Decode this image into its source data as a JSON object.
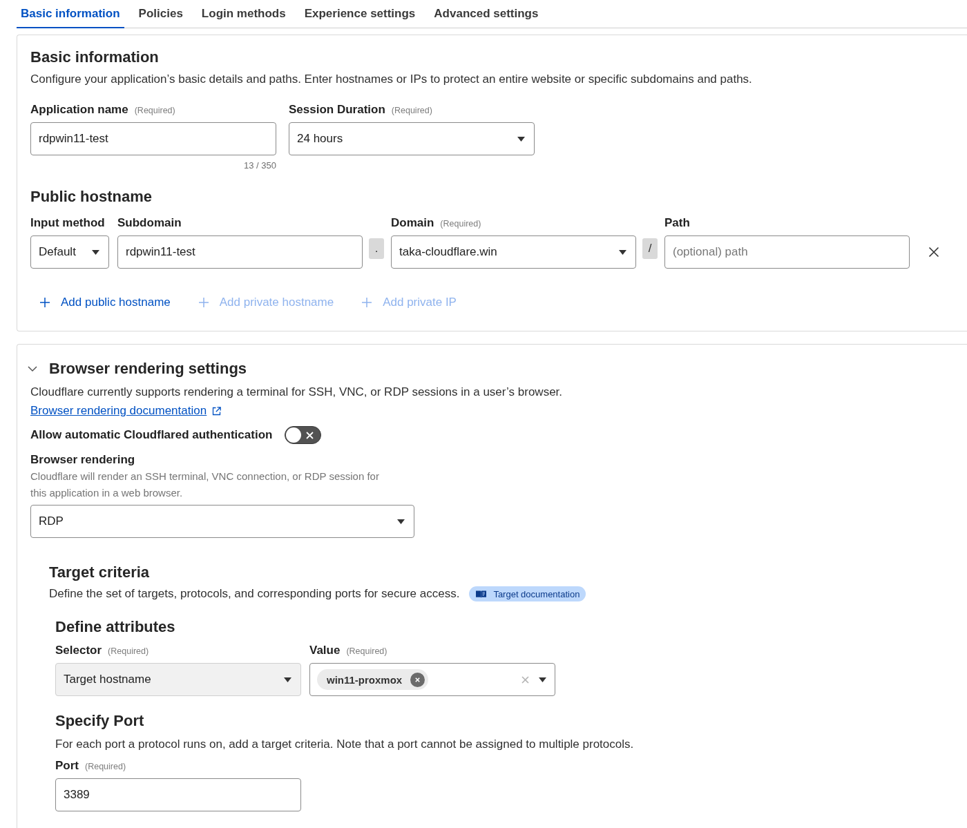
{
  "tabs": [
    {
      "label": "Basic information",
      "selected": true
    },
    {
      "label": "Policies",
      "selected": false
    },
    {
      "label": "Login methods",
      "selected": false
    },
    {
      "label": "Experience settings",
      "selected": false
    },
    {
      "label": "Advanced settings",
      "selected": false
    }
  ],
  "basic_information": {
    "title": "Basic information",
    "description": "Configure your application’s basic details and paths. Enter hostnames or IPs to protect an entire website or specific subdomains and paths.",
    "fields": [
      {
        "kind": "text",
        "label": "Application name",
        "required_note": "(Required)",
        "value": "rdpwin11-test",
        "counter": "13 / 350"
      },
      {
        "kind": "select",
        "label": "Session Duration",
        "required_note": "(Required)",
        "value": "24 hours"
      }
    ]
  },
  "public_hostname": {
    "title": "Public hostname",
    "fields": [
      {
        "kind": "select",
        "label": "Input method",
        "value": "Default"
      },
      {
        "kind": "text",
        "label": "Subdomain",
        "value": "rdpwin11-test"
      },
      {
        "kind": "separator",
        "text": "."
      },
      {
        "kind": "select",
        "label": "Domain",
        "required_note": "(Required)",
        "value": "taka-cloudflare.win"
      },
      {
        "kind": "separator",
        "text": "/"
      },
      {
        "kind": "text",
        "label": "Path",
        "placeholder": "(optional) path"
      }
    ],
    "actions": [
      {
        "label": "Add public hostname",
        "disabled": false
      },
      {
        "label": "Add private hostname",
        "disabled": true
      },
      {
        "label": "Add private IP",
        "disabled": true
      }
    ]
  },
  "browser_rendering": {
    "title": "Browser rendering settings",
    "expanded": true,
    "description": "Cloudflare currently supports rendering a terminal for SSH, VNC, or RDP sessions in a user’s browser.",
    "link": "Browser rendering documentation",
    "toggle": {
      "label": "Allow automatic Cloudflared authentication",
      "on": false
    },
    "rendering": {
      "label": "Browser rendering",
      "hint": "Cloudflare will render an SSH terminal, VNC connection, or RDP session for this application in a web browser.",
      "value": "RDP"
    }
  },
  "target_criteria": {
    "title": "Target criteria",
    "description": "Define the set of targets, protocols, and corresponding ports for secure access.",
    "badge": "Target documentation",
    "attributes": {
      "title": "Define attributes",
      "selector": {
        "label": "Selector",
        "required_note": "(Required)",
        "value": "Target hostname",
        "disabled": true
      },
      "value_field": {
        "label": "Value",
        "required_note": "(Required)",
        "chips": [
          "win11-proxmox"
        ]
      }
    },
    "port": {
      "title": "Specify Port",
      "description": "For each port a protocol runs on, add a target criteria. Note that a port cannot be assigned to multiple protocols.",
      "label": "Port",
      "required_note": "(Required)",
      "value": "3389"
    }
  }
}
